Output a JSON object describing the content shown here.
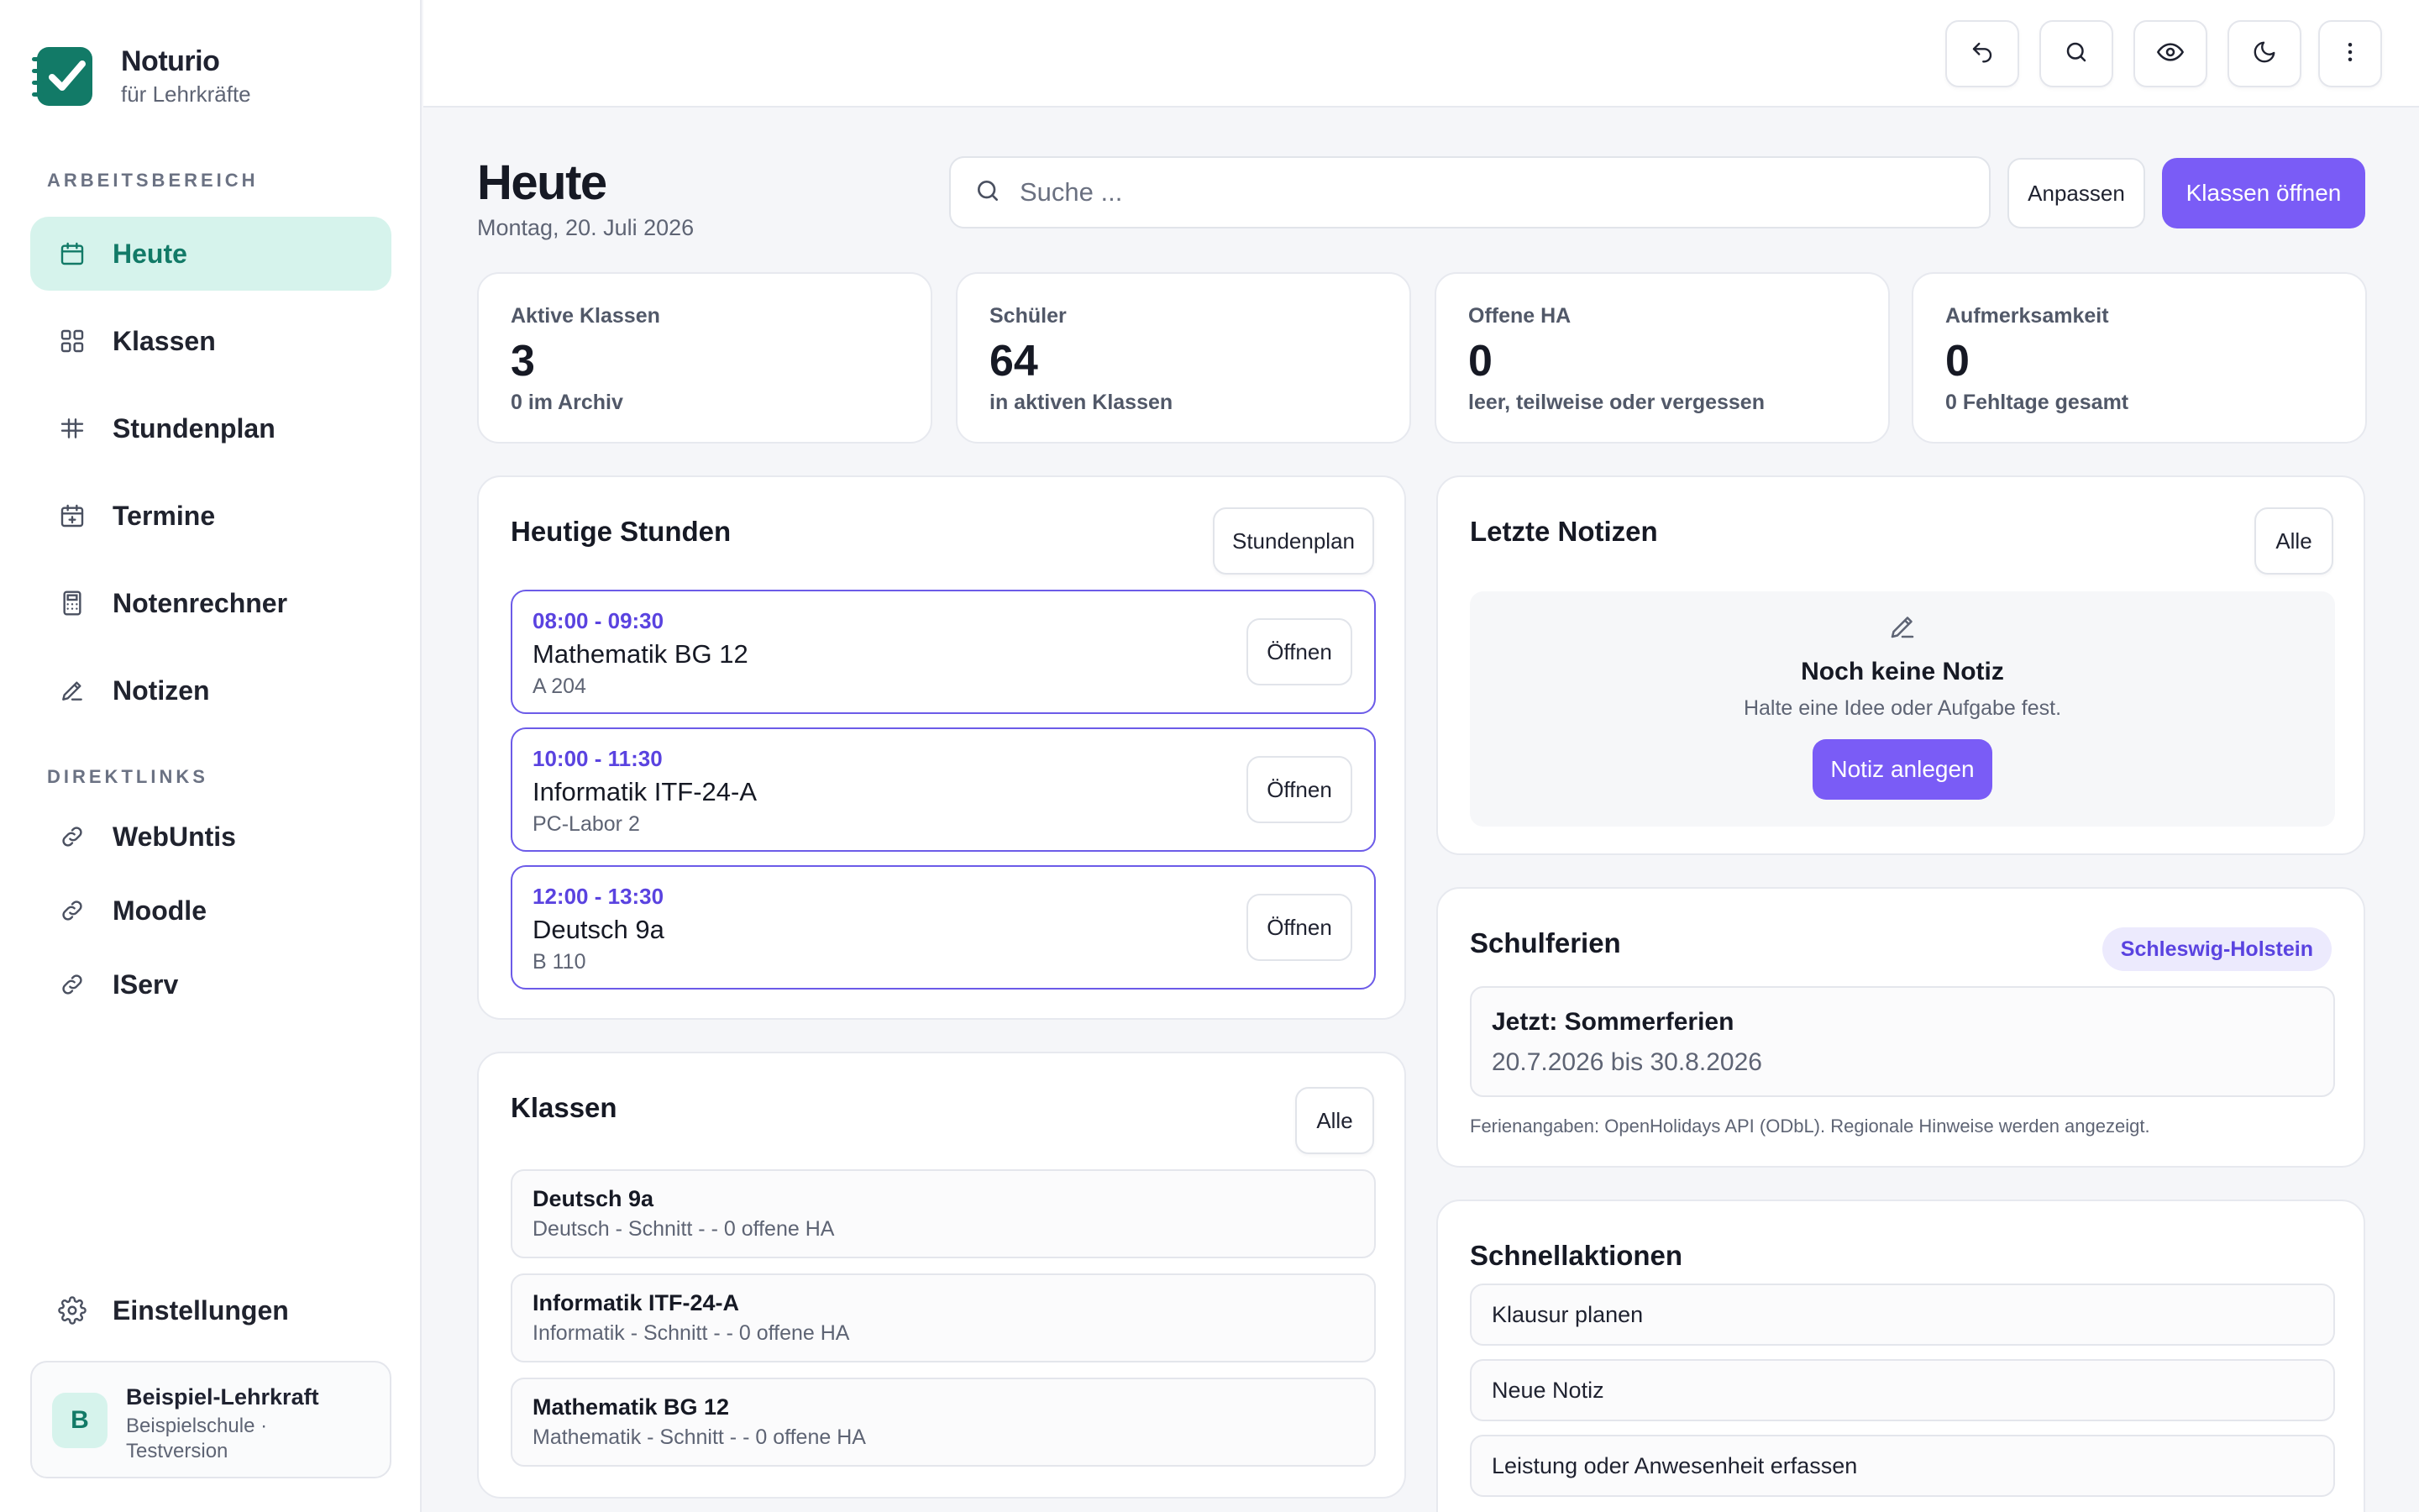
{
  "brand": {
    "name": "Noturio",
    "subtitle": "für Lehrkräfte"
  },
  "sidebar": {
    "section_workspace": "ARBEITSBEREICH",
    "section_links": "DIREKTLINKS",
    "items": [
      {
        "label": "Heute",
        "icon": "calendar-icon",
        "active": true
      },
      {
        "label": "Klassen",
        "icon": "grid-icon"
      },
      {
        "label": "Stundenplan",
        "icon": "table-icon"
      },
      {
        "label": "Termine",
        "icon": "calendar-plus-icon"
      },
      {
        "label": "Notenrechner",
        "icon": "calculator-icon"
      },
      {
        "label": "Notizen",
        "icon": "pencil-icon"
      }
    ],
    "links": [
      {
        "label": "WebUntis",
        "icon": "link-icon"
      },
      {
        "label": "Moodle",
        "icon": "link-icon"
      },
      {
        "label": "IServ",
        "icon": "link-icon"
      }
    ],
    "settings": {
      "label": "Einstellungen",
      "icon": "gear-icon"
    },
    "user": {
      "initial": "B",
      "name": "Beispiel-Lehrkraft",
      "sub": "Beispielschule · Testversion"
    }
  },
  "topbar": {
    "buttons": [
      "undo-icon",
      "search-icon",
      "eye-icon",
      "moon-icon",
      "more-vertical-icon"
    ]
  },
  "header": {
    "title": "Heute",
    "date": "Montag, 20. Juli 2026",
    "search_placeholder": "Suche ...",
    "customize_label": "Anpassen",
    "open_classes_label": "Klassen öffnen"
  },
  "stats": [
    {
      "label": "Aktive Klassen",
      "value": "3",
      "sub": "0 im Archiv"
    },
    {
      "label": "Schüler",
      "value": "64",
      "sub": "in aktiven Klassen"
    },
    {
      "label": "Offene HA",
      "value": "0",
      "sub": "leer, teilweise oder vergessen"
    },
    {
      "label": "Aufmerksamkeit",
      "value": "0",
      "sub": "0 Fehltage gesamt"
    }
  ],
  "today_lessons": {
    "title": "Heutige Stunden",
    "button": "Stundenplan",
    "open_label": "Öffnen",
    "items": [
      {
        "time": "08:00 - 09:30",
        "name": "Mathematik BG 12",
        "room": "A 204"
      },
      {
        "time": "10:00 - 11:30",
        "name": "Informatik ITF-24-A",
        "room": "PC-Labor 2"
      },
      {
        "time": "12:00 - 13:30",
        "name": "Deutsch 9a",
        "room": "B 110"
      }
    ]
  },
  "classes": {
    "title": "Klassen",
    "button": "Alle",
    "items": [
      {
        "name": "Deutsch 9a",
        "sub": "Deutsch - Schnitt - - 0 offene HA"
      },
      {
        "name": "Informatik ITF-24-A",
        "sub": "Informatik - Schnitt - - 0 offene HA"
      },
      {
        "name": "Mathematik BG 12",
        "sub": "Mathematik - Schnitt - - 0 offene HA"
      }
    ]
  },
  "notes": {
    "title": "Letzte Notizen",
    "button": "Alle",
    "empty_title": "Noch keine Notiz",
    "empty_sub": "Halte eine Idee oder Aufgabe fest.",
    "create_label": "Notiz anlegen"
  },
  "holidays": {
    "title": "Schulferien",
    "region": "Schleswig-Holstein",
    "current": "Jetzt: Sommerferien",
    "dates": "20.7.2026 bis 30.8.2026",
    "note": "Ferienangaben: OpenHolidays API (ODbL). Regionale Hinweise werden angezeigt."
  },
  "quick_actions": {
    "title": "Schnellaktionen",
    "items": [
      "Klausur planen",
      "Neue Notiz",
      "Leistung oder Anwesenheit erfassen"
    ]
  },
  "colors": {
    "accent": "#7a5cf6",
    "brand_green": "#127a67",
    "active_bg": "#d6f3ec",
    "lesson_border": "#6c5be8"
  }
}
